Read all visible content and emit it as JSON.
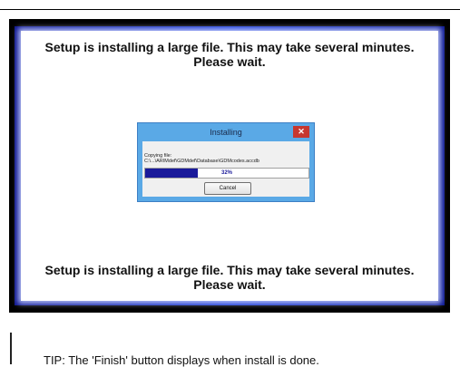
{
  "banner": {
    "top_line1": "Setup is installing a large file. This may take several minutes.",
    "top_line2": "Please wait.",
    "bottom_line1": "Setup is installing a large file. This may take several minutes.",
    "bottom_line2": "Please wait."
  },
  "dialog": {
    "title": "Installing",
    "close_icon": "close-icon",
    "copy_label": "Copying file:",
    "copy_path": "C:\\...\\ARIMdef\\GDMdef\\Database\\GDMcodes.accdb",
    "progress_percent": "32%",
    "progress_fraction": 0.32,
    "cancel_label": "Cancel"
  },
  "tip": "TIP: The 'Finish' button displays when install is done.",
  "colors": {
    "frame_blue": "#0d2fd4",
    "progress_fill": "#1a1a9a",
    "close_red": "#c7372f"
  }
}
